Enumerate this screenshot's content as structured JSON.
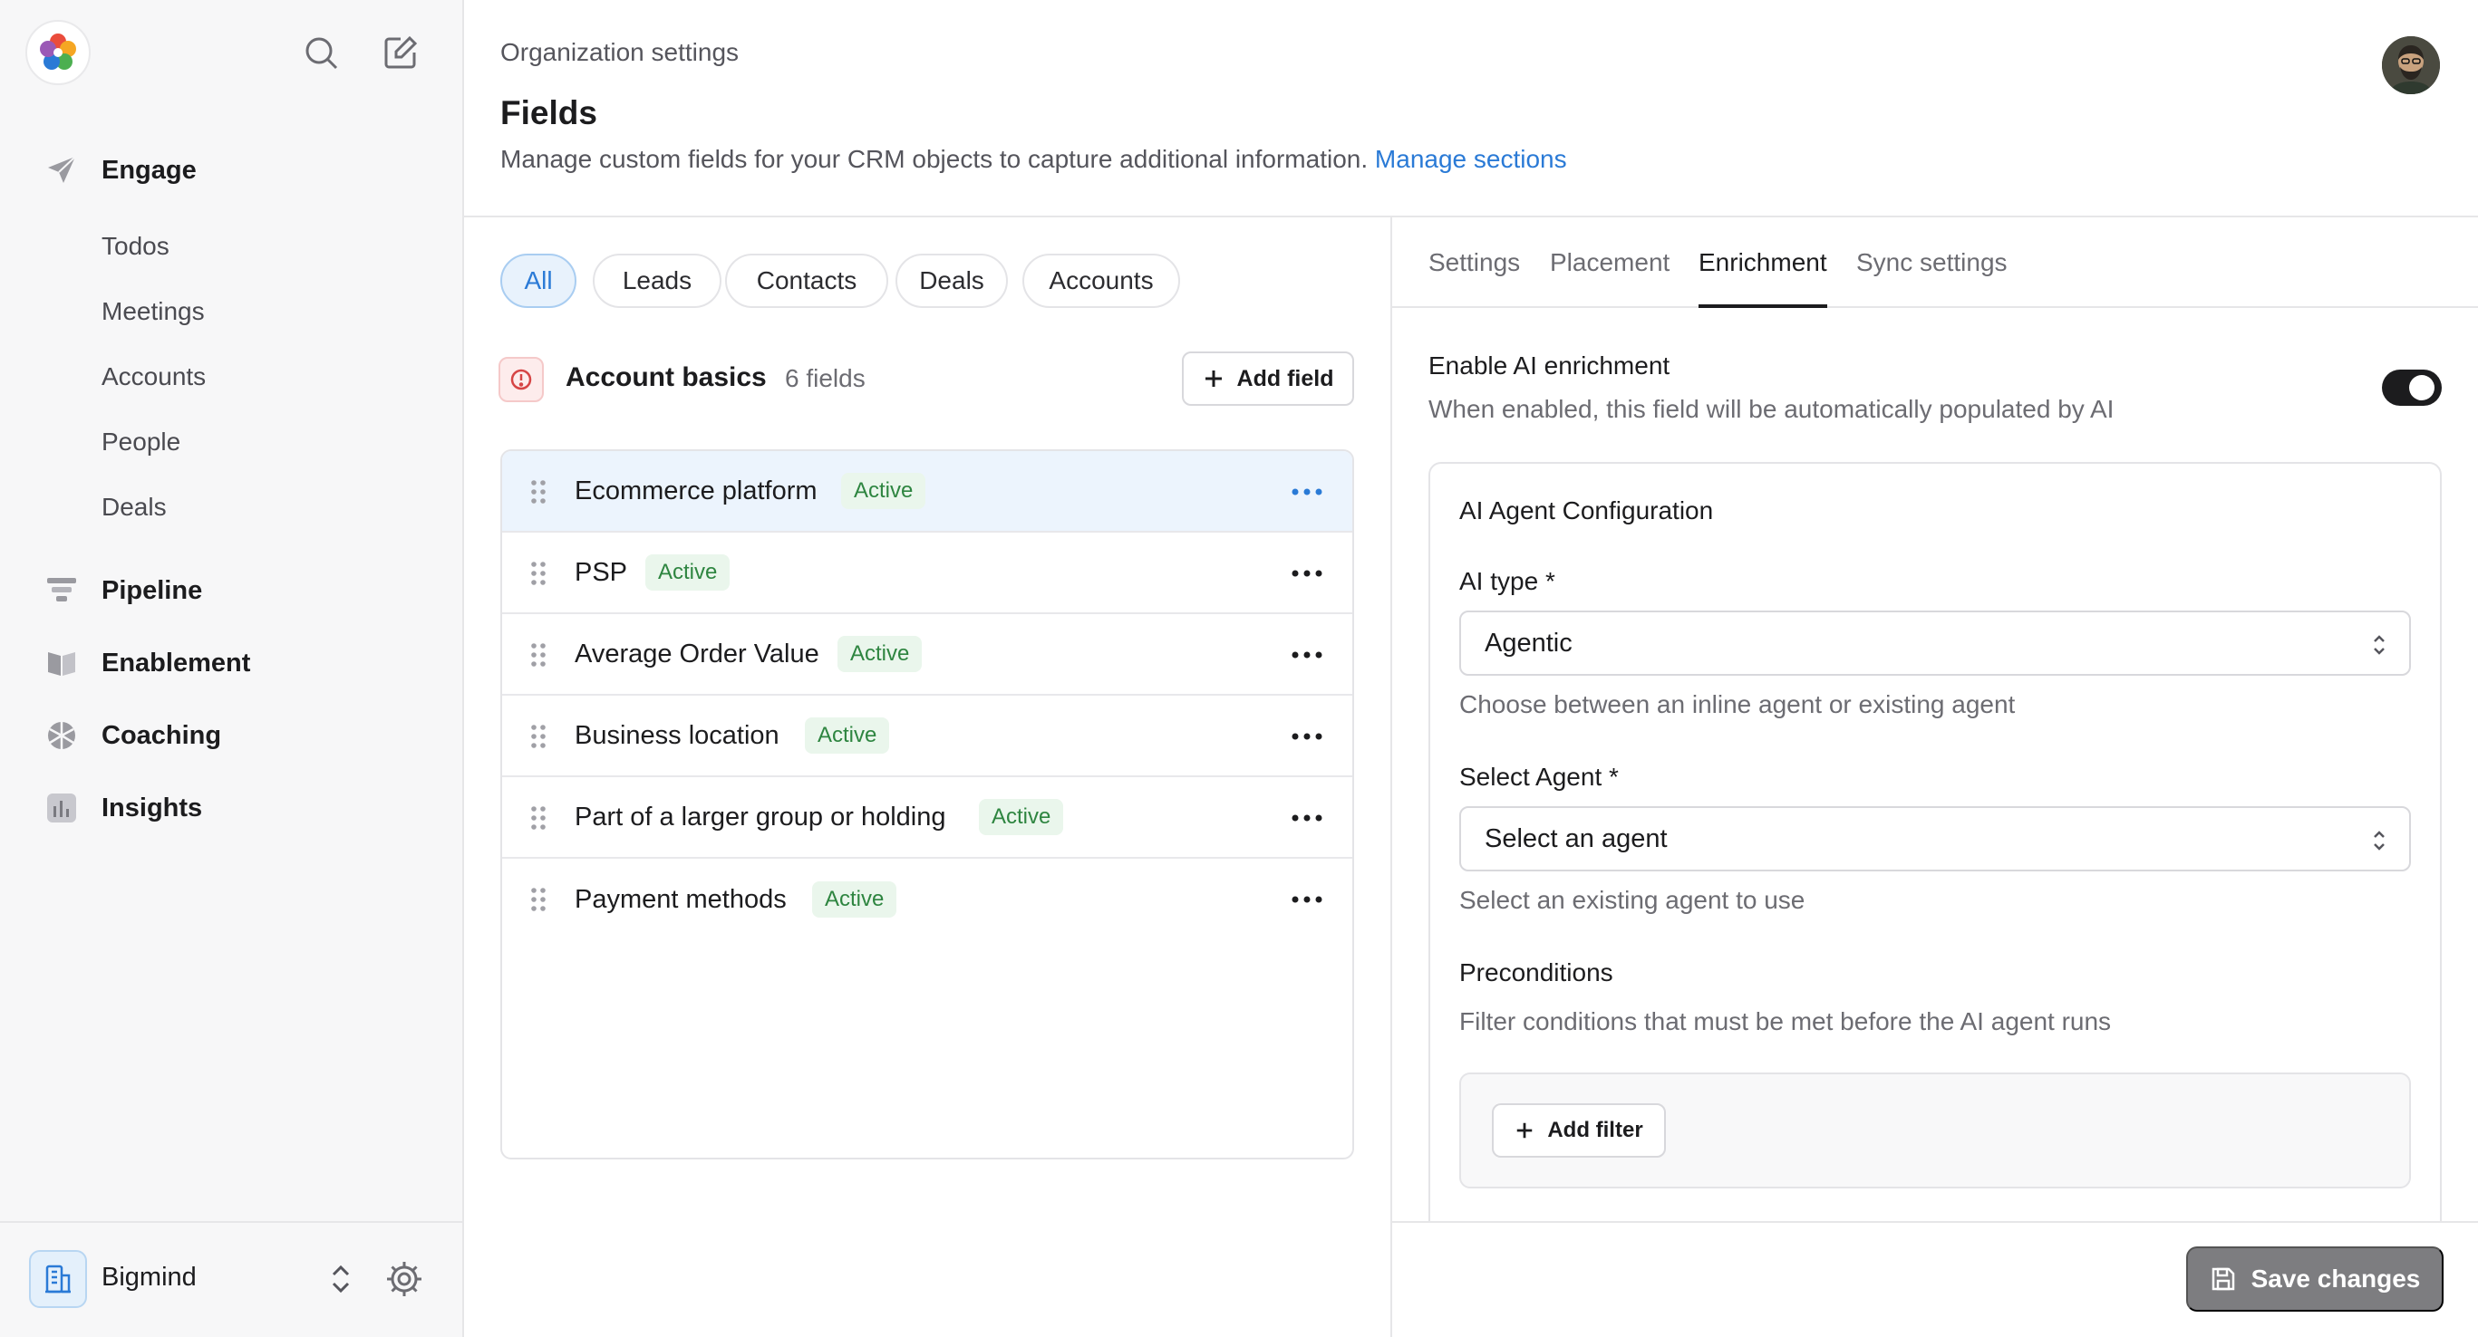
{
  "sidebar": {
    "nav": [
      {
        "label": "Engage",
        "icon": "paper-plane-icon"
      },
      {
        "label": "Pipeline",
        "icon": "funnel-icon"
      },
      {
        "label": "Enablement",
        "icon": "book-icon"
      },
      {
        "label": "Coaching",
        "icon": "aperture-icon"
      },
      {
        "label": "Insights",
        "icon": "bar-chart-icon"
      }
    ],
    "engage_sub": [
      "Todos",
      "Meetings",
      "Accounts",
      "People",
      "Deals"
    ],
    "workspace": "Bigmind"
  },
  "header": {
    "breadcrumb": "Organization settings",
    "title": "Fields",
    "description": "Manage custom fields for your CRM objects to capture additional information.",
    "manage_link": "Manage sections"
  },
  "filters": {
    "pills": [
      "All",
      "Leads",
      "Contacts",
      "Deals",
      "Accounts"
    ],
    "active": "All"
  },
  "section": {
    "title": "Account basics",
    "count": "6 fields",
    "add_label": "Add field"
  },
  "fields": [
    {
      "name": "Ecommerce platform",
      "status": "Active"
    },
    {
      "name": "PSP",
      "status": "Active"
    },
    {
      "name": "Average Order Value",
      "status": "Active"
    },
    {
      "name": "Business location",
      "status": "Active"
    },
    {
      "name": "Part of a larger group or holding",
      "status": "Active"
    },
    {
      "name": "Payment methods",
      "status": "Active"
    }
  ],
  "tabs": [
    "Settings",
    "Placement",
    "Enrichment",
    "Sync settings"
  ],
  "enrichment": {
    "title": "Enable AI enrichment",
    "description": "When enabled, this field will be automatically populated by AI",
    "enabled": true,
    "card_title": "AI Agent Configuration",
    "ai_type_label": "AI type *",
    "ai_type_value": "Agentic",
    "ai_type_help": "Choose between an inline agent or existing agent",
    "agent_label": "Select Agent *",
    "agent_placeholder": "Select an agent",
    "agent_help": "Select an existing agent to use",
    "preconditions_label": "Preconditions",
    "preconditions_help": "Filter conditions that must be met before the AI agent runs",
    "add_filter": "Add filter"
  },
  "save_label": "Save changes",
  "colors": {
    "accent": "#2a7ad6",
    "active_badge": "#2e8540",
    "save_disabled": "#7d7d80"
  }
}
